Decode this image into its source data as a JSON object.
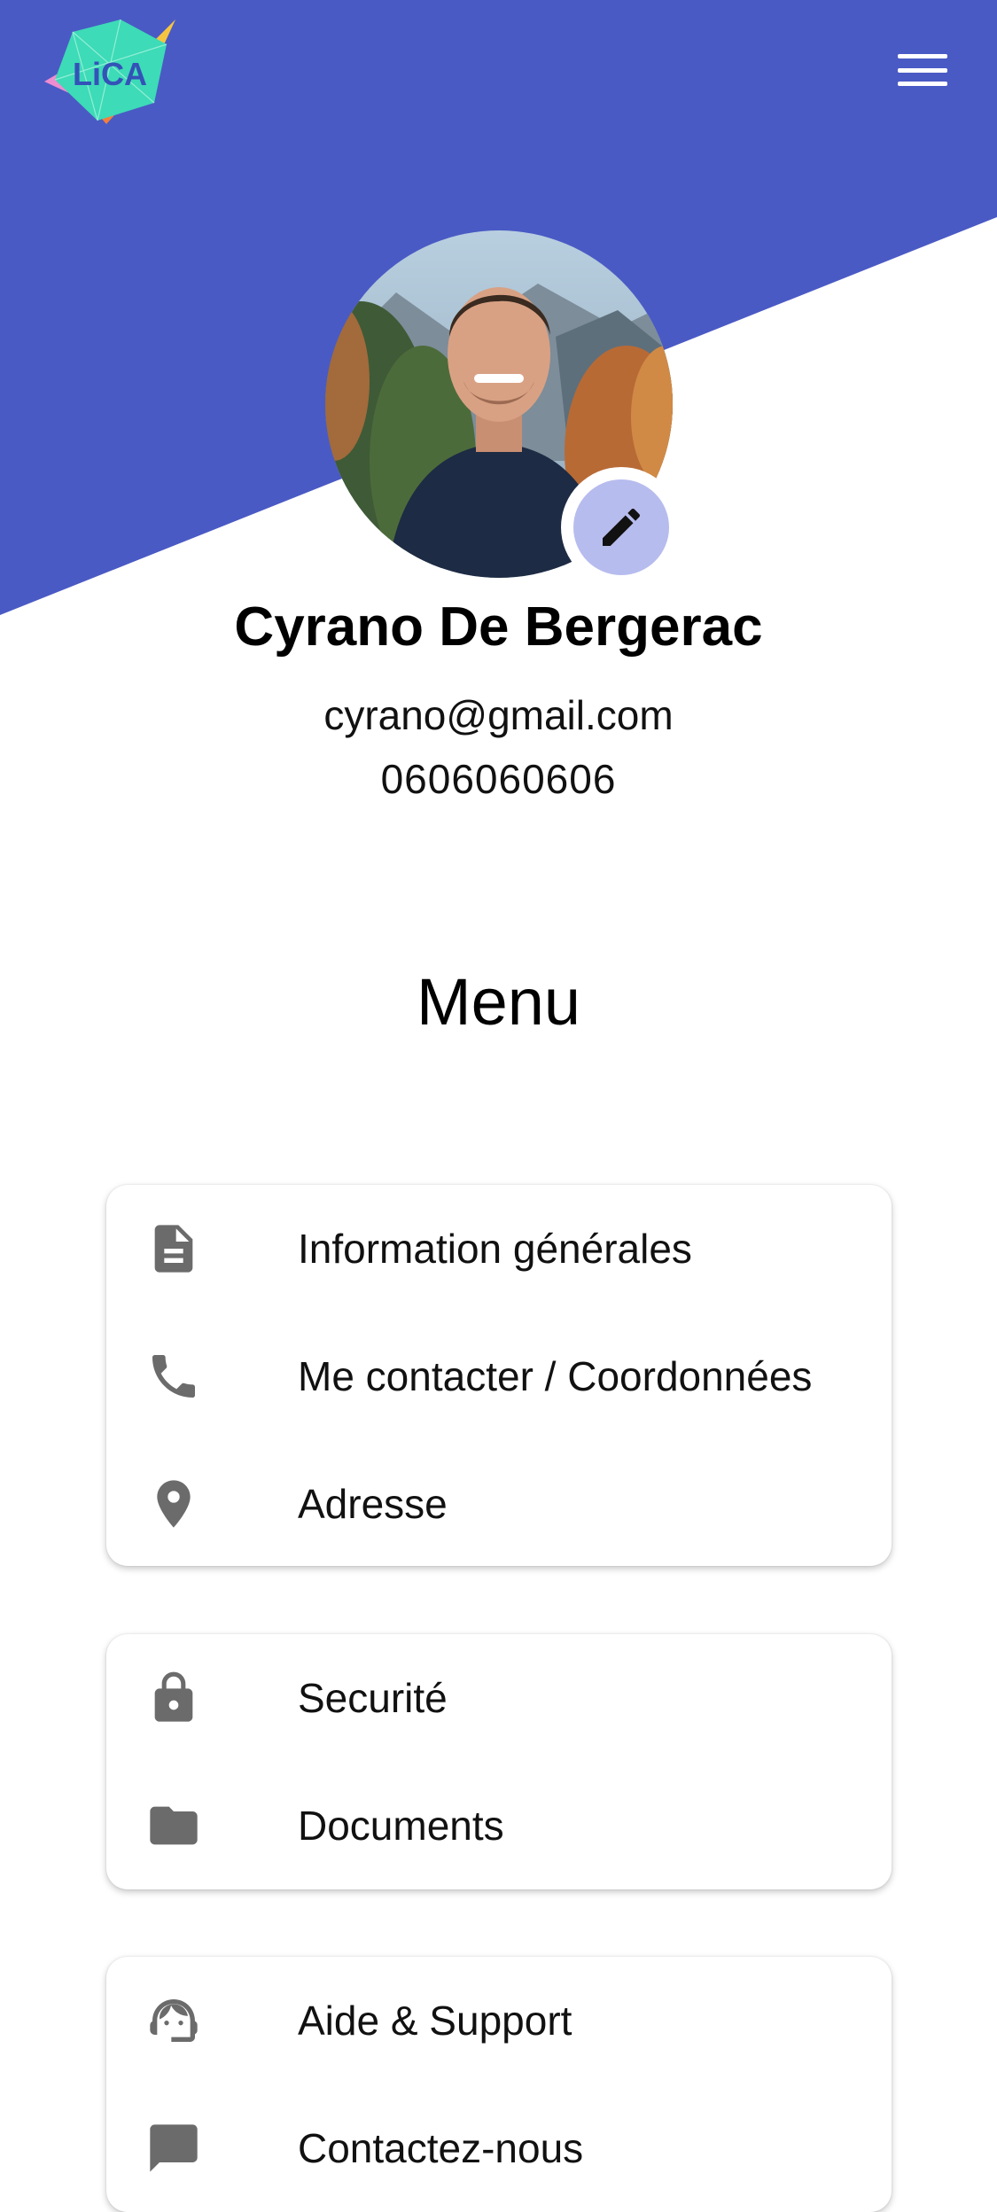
{
  "brand": {
    "logo_text": "LiCA",
    "primary_color": "#4a5ac4",
    "accent_color": "#b7bcee"
  },
  "header": {
    "menu_icon": "hamburger-menu-icon"
  },
  "profile": {
    "name": "Cyrano De Bergerac",
    "email": "cyrano@gmail.com",
    "phone": "0606060606",
    "edit_icon": "pencil-icon"
  },
  "menu": {
    "title": "Menu",
    "groups": [
      {
        "items": [
          {
            "label": "Information générales",
            "icon": "document-icon"
          },
          {
            "label": "Me contacter / Coordonnées",
            "icon": "phone-icon"
          },
          {
            "label": "Adresse",
            "icon": "location-pin-icon"
          }
        ]
      },
      {
        "items": [
          {
            "label": "Securité",
            "icon": "lock-icon"
          },
          {
            "label": "Documents",
            "icon": "folder-icon"
          }
        ]
      },
      {
        "items": [
          {
            "label": "Aide & Support",
            "icon": "support-agent-icon"
          },
          {
            "label": "Contactez-nous",
            "icon": "message-icon"
          }
        ]
      }
    ]
  }
}
